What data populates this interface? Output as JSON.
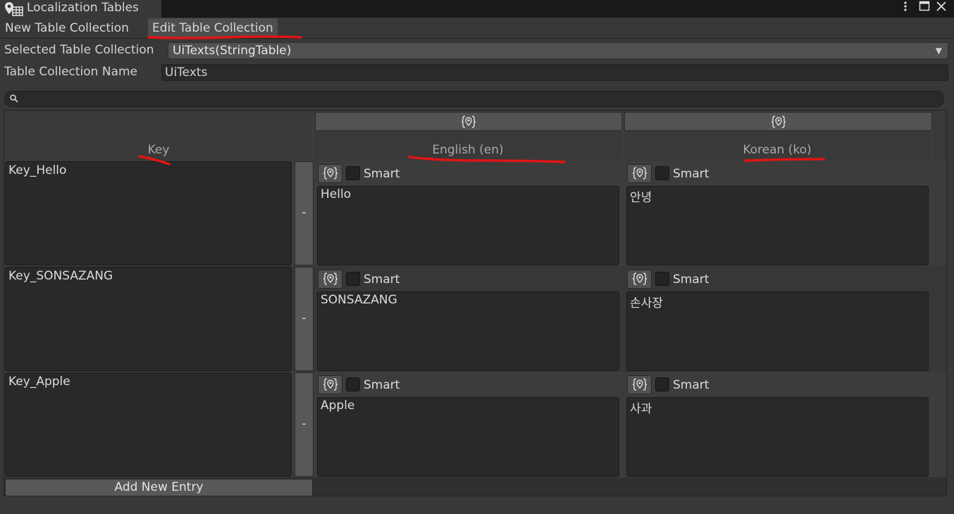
{
  "window": {
    "title": "Localization Tables",
    "icons": [
      "map-pin-table-icon",
      "more-vert-icon",
      "maximize-icon",
      "close-icon"
    ]
  },
  "tabs": [
    {
      "label": "New Table Collection",
      "selected": false
    },
    {
      "label": "Edit Table Collection",
      "selected": true
    }
  ],
  "fields": {
    "selected_label": "Selected Table Collection",
    "selected_value": "UiTexts(StringTable)",
    "name_label": "Table Collection Name",
    "name_value": "UiTexts"
  },
  "search": {
    "placeholder": ""
  },
  "table": {
    "columns": [
      {
        "label": "Key"
      },
      {
        "label": "English (en)"
      },
      {
        "label": "Korean (ko)"
      }
    ],
    "smart_label": "Smart",
    "remove_label": "-",
    "rows": [
      {
        "key": "Key_Hello",
        "en": "Hello",
        "ko": "안녕"
      },
      {
        "key": "Key_SONSAZANG",
        "en": "SONSAZANG",
        "ko": "손사장"
      },
      {
        "key": "Key_Apple",
        "en": "Apple",
        "ko": "사과"
      }
    ],
    "add_entry_label": "Add New Entry"
  },
  "colors": {
    "background": "#383838",
    "annotation": "#e01515"
  }
}
